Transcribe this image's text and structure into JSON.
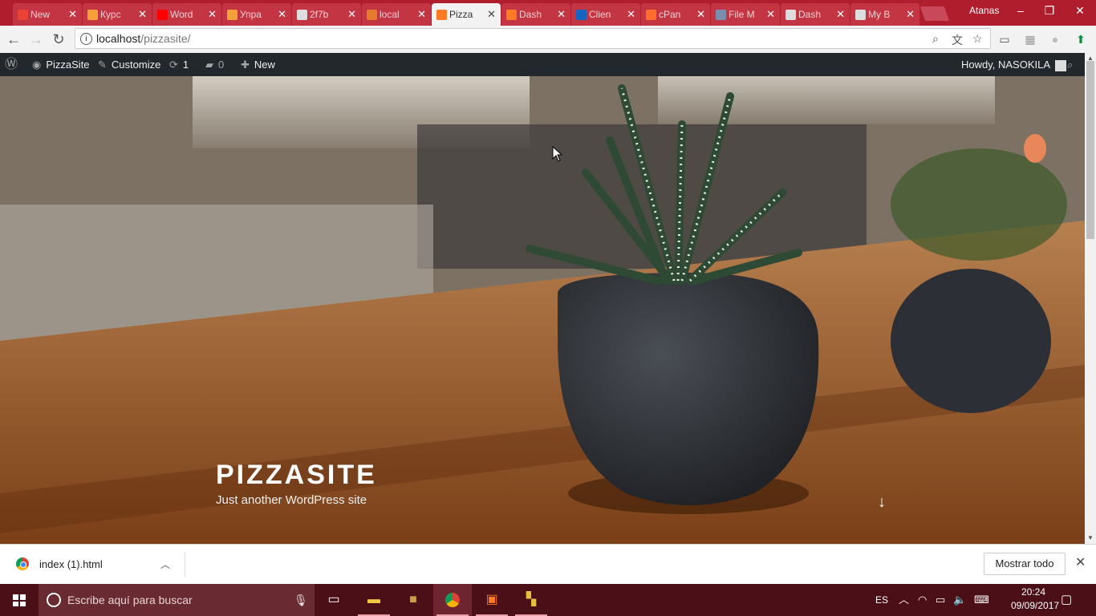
{
  "browser": {
    "tabs": [
      {
        "label": "New",
        "color": "#ea4335"
      },
      {
        "label": "Курс",
        "color": "#f4a13a"
      },
      {
        "label": "Word",
        "color": "#ff0000"
      },
      {
        "label": "Упра",
        "color": "#f4a13a"
      },
      {
        "label": "2f7b",
        "color": "#ddd"
      },
      {
        "label": "local",
        "color": "#e47a2c"
      },
      {
        "label": "Pizza",
        "color": "#fb7a24"
      },
      {
        "label": "Dash",
        "color": "#fb7a24"
      },
      {
        "label": "Clien",
        "color": "#1565c0"
      },
      {
        "label": "cPan",
        "color": "#ff6c2c"
      },
      {
        "label": "File M",
        "color": "#7a8fb0"
      },
      {
        "label": "Dash",
        "color": "#ddd"
      },
      {
        "label": "My B",
        "color": "#ddd"
      }
    ],
    "active_tab_index": 6,
    "profile_name": "Atanas",
    "url_host": "localhost",
    "url_path": "/pizzasite/"
  },
  "adminbar": {
    "site_name": "PizzaSite",
    "customize": "Customize",
    "updates_count": "1",
    "comments_count": "0",
    "new_label": "New",
    "howdy": "Howdy, NASOKILA"
  },
  "hero": {
    "site_title": "PIZZASITE",
    "tagline": "Just another WordPress site"
  },
  "downloads": {
    "file_name": "index (1).html",
    "show_all": "Mostrar todo"
  },
  "taskbar": {
    "search_placeholder": "Escribe aquí para buscar",
    "language": "ES",
    "time": "20:24",
    "date": "09/09/2017"
  }
}
